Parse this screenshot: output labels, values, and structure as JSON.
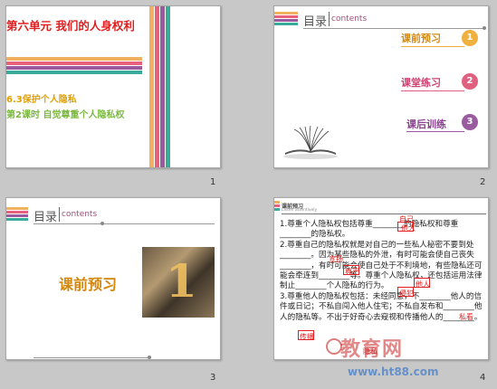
{
  "colors": {
    "stripe_pink": "#e8607c",
    "stripe_orange": "#f0b060",
    "stripe_teal": "#3aaa9a",
    "stripe_purple": "#9a5aa0",
    "badge_orange": "#f0b040",
    "badge_pink": "#e06080",
    "badge_purple": "#9a5aa0"
  },
  "slides": [
    {
      "number": "1",
      "title": "第六单元  我们的人身权利",
      "lesson": "6.3保护个人隐私",
      "period": "第2课时   自觉尊重个人隐私权"
    },
    {
      "number": "2",
      "header_title": "目录",
      "header_sub": "contents",
      "menu": [
        {
          "label": "课前预习",
          "badge": "1"
        },
        {
          "label": "课堂练习",
          "badge": "2"
        },
        {
          "label": "课后训练",
          "badge": "3"
        }
      ],
      "image_icon": "book-icon"
    },
    {
      "number": "3",
      "header_title": "目录",
      "header_sub": "contents",
      "big_label": "课前预习",
      "photo_numeral": "1"
    },
    {
      "number": "4",
      "tag": "课前预习",
      "tag_sub": "Listen attentively",
      "paragraphs": [
        "1.尊重个人隐私权包括尊重________的隐私权和尊重________的隐私权。",
        "2.尊重自己的隐私权就是对自己的一些私人秘密不要到处________。因为某些隐私的外泄，有时可能会使自己丧失________，有时可能会使自己处于不利境地，有些隐私还可能会牵连到________等。尊重个人隐私权，还包括运用法律制止________个人隐私的行为。",
        "3.尊重他人的隐私权包括：未经同意，不________他人的信件或日记；不私自闯入他人住宅；不私自发布和________他人的隐私等。不出于好奇心去窥视和传播他人的________。"
      ],
      "answers": [
        "自己",
        "他人",
        "宣扬",
        "尊严",
        "他人",
        "侵犯",
        "私看",
        "传播",
        "隐私"
      ],
      "watermark": "教育网",
      "watermark_url": "www.ht88.com"
    }
  ]
}
